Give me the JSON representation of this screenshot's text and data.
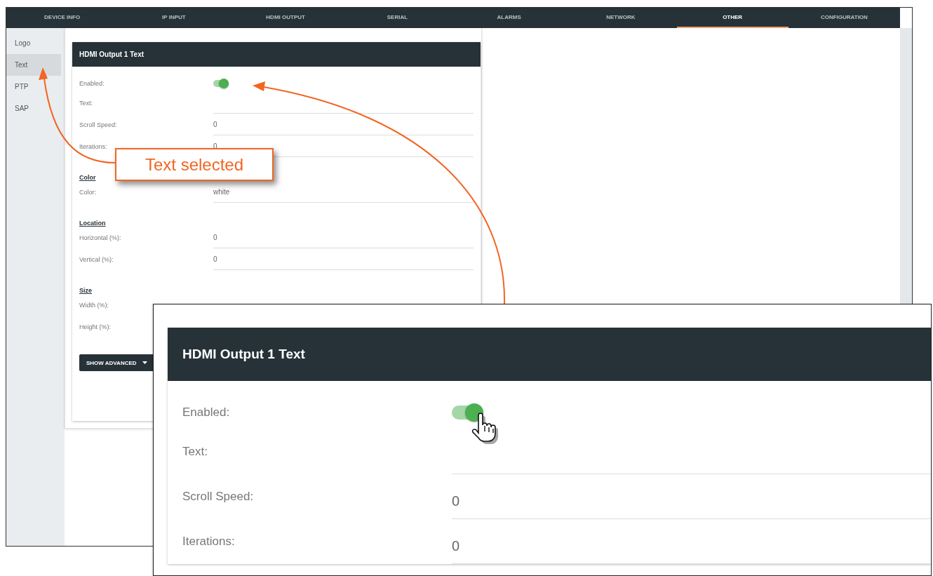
{
  "nav_tabs": [
    {
      "label": "DEVICE INFO",
      "selected": false
    },
    {
      "label": "IP INPUT",
      "selected": false
    },
    {
      "label": "HDMI OUTPUT",
      "selected": false
    },
    {
      "label": "SERIAL",
      "selected": false
    },
    {
      "label": "ALARMS",
      "selected": false
    },
    {
      "label": "NETWORK",
      "selected": false
    },
    {
      "label": "OTHER",
      "selected": true
    },
    {
      "label": "CONFIGURATION",
      "selected": false
    }
  ],
  "sidebar": {
    "items": [
      {
        "label": "Logo",
        "selected": false
      },
      {
        "label": "Text",
        "selected": true
      },
      {
        "label": "PTP",
        "selected": false
      },
      {
        "label": "SAP",
        "selected": false
      }
    ]
  },
  "panel": {
    "title": "HDMI Output 1 Text",
    "items": [
      {
        "kind": "toggle",
        "label": "Enabled:",
        "on": true
      },
      {
        "kind": "field",
        "label": "Text:"
      },
      {
        "kind": "field",
        "label": "Scroll Speed:",
        "value": "0"
      },
      {
        "kind": "field",
        "label": "Iterations:",
        "value": "0"
      },
      {
        "kind": "heading",
        "label": "Color"
      },
      {
        "kind": "field",
        "label": "Color:",
        "value": "white"
      },
      {
        "kind": "heading",
        "label": "Location"
      },
      {
        "kind": "field",
        "label": "Horizontal (%):",
        "value": "0"
      },
      {
        "kind": "field",
        "label": "Vertical (%):",
        "value": "0"
      },
      {
        "kind": "heading",
        "label": "Size"
      },
      {
        "kind": "label",
        "label": "Width (%):"
      },
      {
        "kind": "label",
        "label": "Height (%):"
      }
    ],
    "button": "SHOW ADVANCED"
  },
  "callout": {
    "text": "Text selected"
  },
  "inset": {
    "title": "HDMI Output 1 Text",
    "items": [
      {
        "kind": "toggle",
        "label": "Enabled:",
        "on": true
      },
      {
        "kind": "field",
        "label": "Text:"
      },
      {
        "kind": "field",
        "label": "Scroll Speed:",
        "value": "0"
      },
      {
        "kind": "field",
        "label": "Iterations:",
        "value": "0"
      }
    ]
  }
}
